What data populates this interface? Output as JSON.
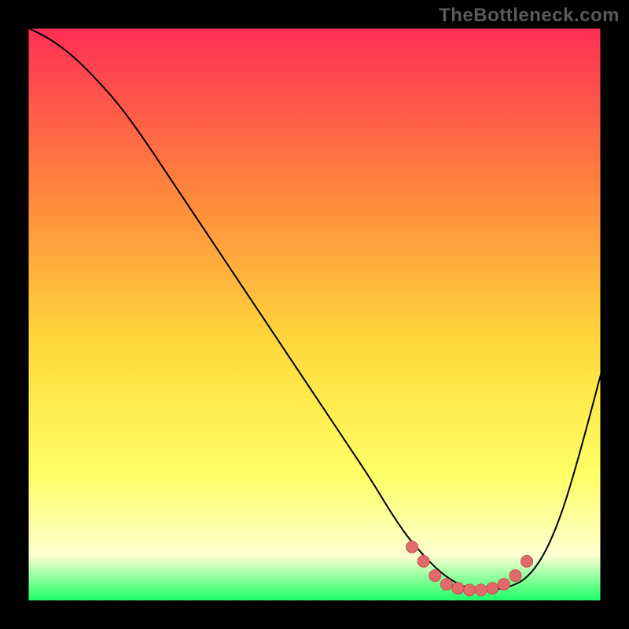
{
  "watermark": "TheBottleneck.com",
  "colors": {
    "frame": "#000000",
    "curve": "#000000",
    "marker_fill": "#e16a6a",
    "marker_stroke": "#c94f4f",
    "gradient_top": "#ff2e55",
    "gradient_mid1": "#ff8a3c",
    "gradient_mid2": "#ffd93b",
    "gradient_mid3": "#ffff66",
    "gradient_low": "#fdffd0",
    "gradient_bottom": "#19ff66"
  },
  "chart_data": {
    "type": "line",
    "title": "",
    "xlabel": "",
    "ylabel": "",
    "xlim": [
      0,
      100
    ],
    "ylim": [
      0,
      100
    ],
    "grid": false,
    "legend": false,
    "series": [
      {
        "name": "bottleneck-curve",
        "x": [
          0,
          4,
          8,
          12,
          16,
          20,
          24,
          28,
          32,
          36,
          40,
          44,
          48,
          52,
          56,
          60,
          63,
          66,
          69,
          72,
          75,
          78,
          81,
          84,
          87,
          90,
          93,
          96,
          100
        ],
        "values": [
          100,
          98,
          95,
          91,
          86.5,
          81,
          75,
          69,
          63,
          57,
          51,
          45,
          39,
          33,
          27,
          21,
          16,
          11.5,
          8,
          5,
          3,
          2,
          2,
          2.5,
          4,
          8,
          15,
          25,
          40
        ]
      }
    ],
    "markers": {
      "name": "valley-markers",
      "x": [
        67,
        69,
        71,
        73,
        75,
        77,
        79,
        81,
        83,
        85,
        87
      ],
      "values": [
        9.5,
        7,
        4.5,
        3,
        2.3,
        2,
        2,
        2.3,
        3,
        4.5,
        7
      ]
    }
  }
}
